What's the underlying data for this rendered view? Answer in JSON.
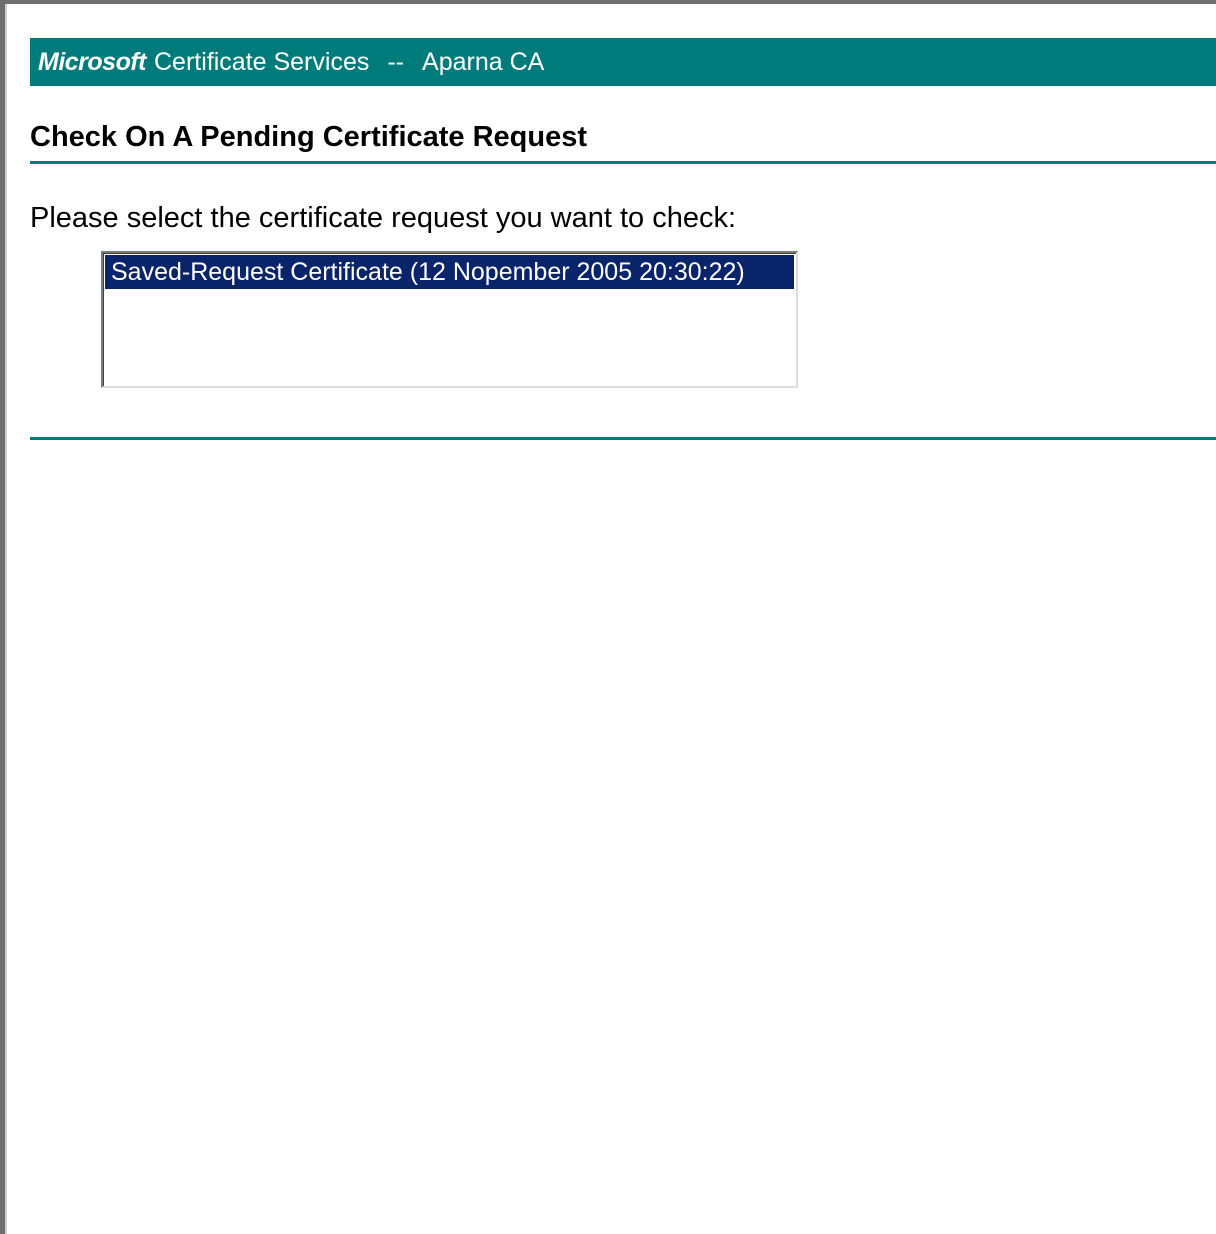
{
  "header": {
    "brand": "Microsoft",
    "service": "Certificate Services",
    "separator": "--",
    "ca_name": "Aparna CA"
  },
  "page": {
    "title": "Check On A Pending Certificate Request",
    "prompt": "Please select the certificate request you want to check:"
  },
  "request_list": {
    "options": [
      {
        "label": "Saved-Request Certificate (12 Nopember 2005 20:30:22)",
        "selected": true
      }
    ]
  },
  "colors": {
    "accent": "#007b7b",
    "selection": "#0a246a",
    "frame": "#6f6f6f"
  }
}
